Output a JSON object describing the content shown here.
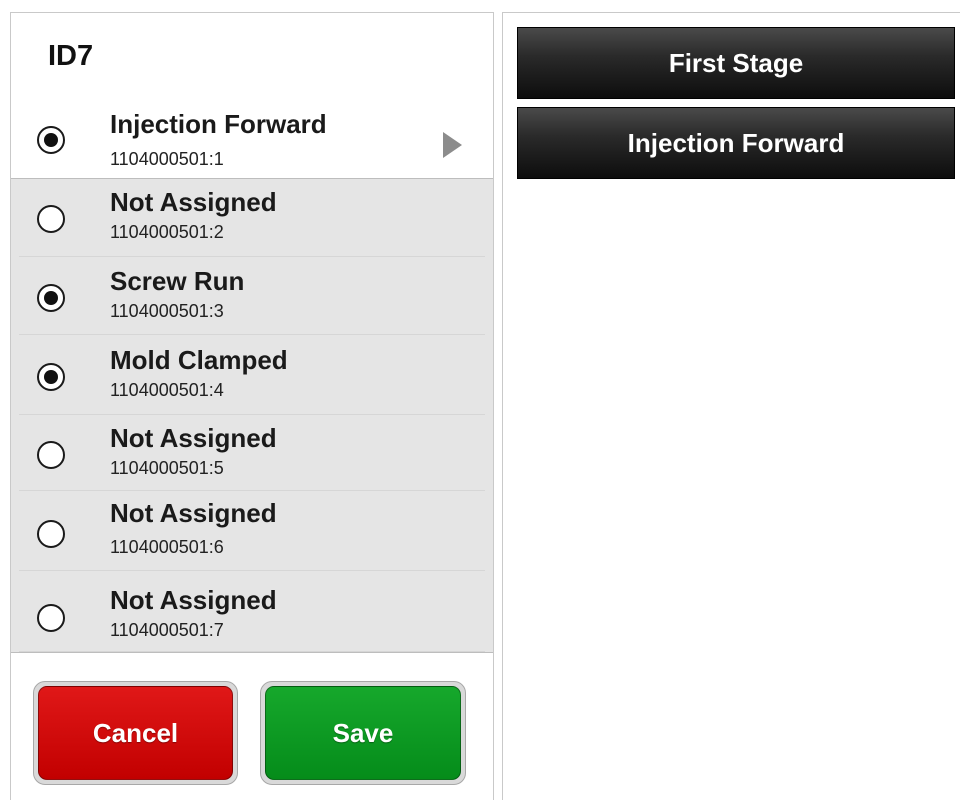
{
  "panel": {
    "title": "ID7"
  },
  "items": [
    {
      "label": "Injection Forward",
      "code": "1104000501:1",
      "checked": true
    },
    {
      "label": "Not Assigned",
      "code": "1104000501:2",
      "checked": false
    },
    {
      "label": "Screw Run",
      "code": "1104000501:3",
      "checked": true
    },
    {
      "label": "Mold Clamped",
      "code": "1104000501:4",
      "checked": true
    },
    {
      "label": "Not Assigned",
      "code": "1104000501:5",
      "checked": false
    },
    {
      "label": "Not Assigned",
      "code": "1104000501:6",
      "checked": false
    },
    {
      "label": "Not Assigned",
      "code": "1104000501:7",
      "checked": false
    }
  ],
  "footer": {
    "cancel_label": "Cancel",
    "save_label": "Save"
  },
  "right": {
    "stage_label": "First Stage",
    "function_label": "Injection Forward"
  },
  "icons": {
    "selected_arrow": "chevron-right-icon",
    "radio_on": "radio-checked-icon",
    "radio_off": "radio-unchecked-icon"
  },
  "colors": {
    "cancel": "#c20000",
    "save": "#058c1a",
    "dark_button": "#1a1a1a"
  }
}
